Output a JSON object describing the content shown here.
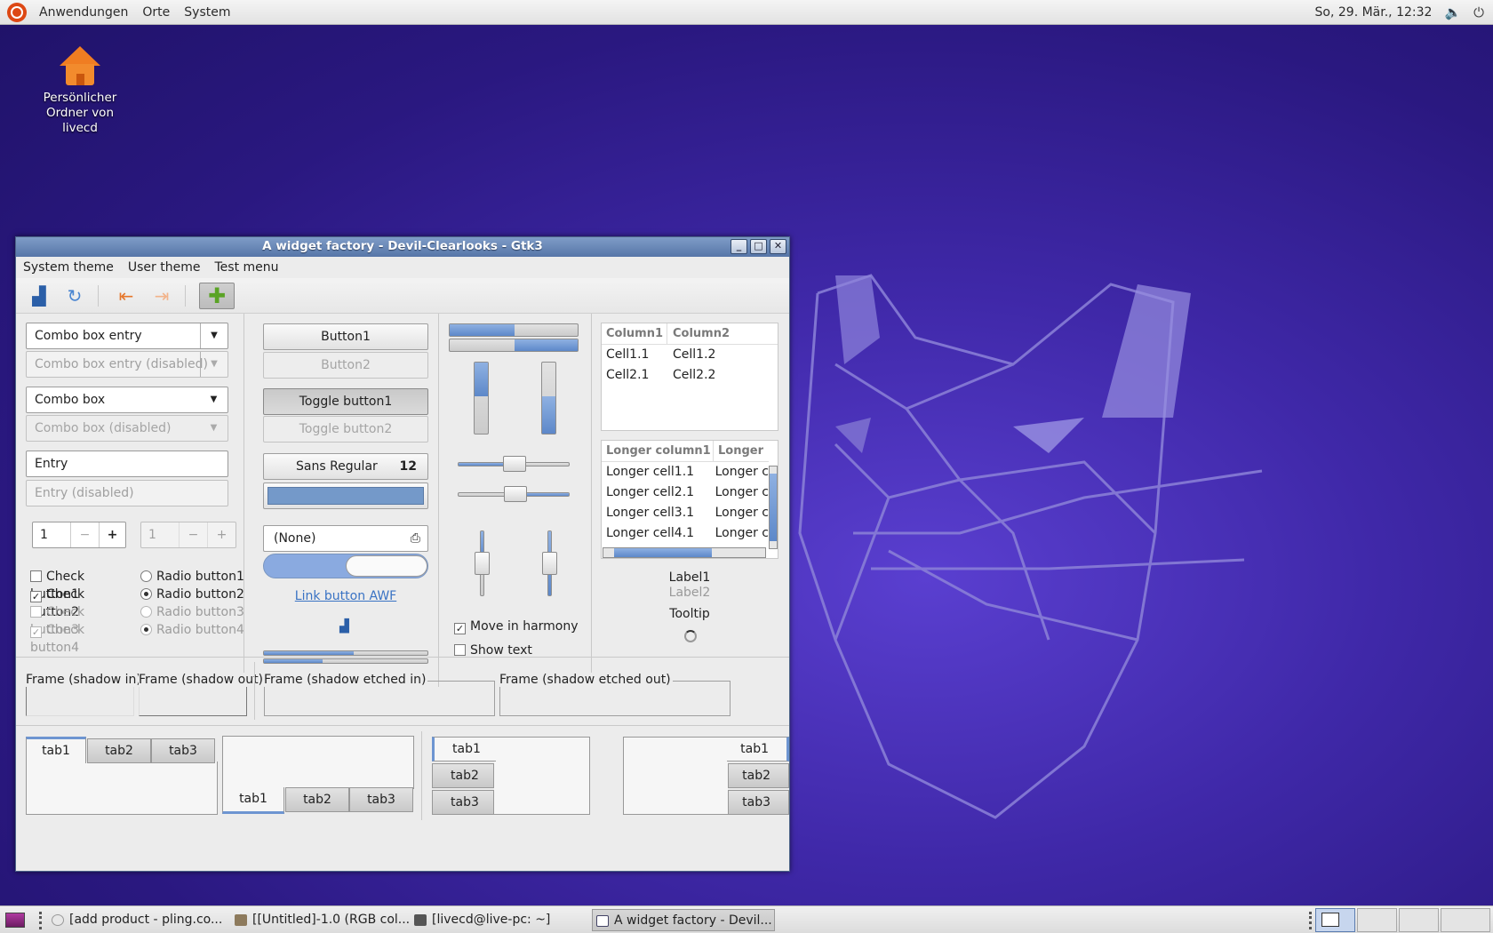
{
  "top_panel": {
    "menus": [
      "Anwendungen",
      "Orte",
      "System"
    ],
    "clock": "So, 29. Mär., 12:32"
  },
  "desktop": {
    "home_icon_label_line1": "Persönlicher",
    "home_icon_label_line2": "Ordner von livecd"
  },
  "window": {
    "title": "A widget factory - Devil-Clearlooks - Gtk3",
    "menubar": [
      "System theme",
      "User theme",
      "Test menu"
    ],
    "col1": {
      "combo_entry": "Combo box entry",
      "combo_entry_disabled": "Combo box entry (disabled)",
      "combo": "Combo box",
      "combo_disabled": "Combo box (disabled)",
      "entry": "Entry",
      "entry_disabled": "Entry (disabled)",
      "spin1": "1",
      "spin2": "1",
      "checks": [
        {
          "label": "Check button1",
          "checked": false,
          "disabled": false
        },
        {
          "label": "Check button2",
          "checked": true,
          "disabled": false
        },
        {
          "label": "Check button3",
          "checked": false,
          "disabled": true
        },
        {
          "label": "Check button4",
          "checked": true,
          "disabled": true
        }
      ],
      "radios": [
        {
          "label": "Radio button1",
          "checked": false,
          "disabled": false
        },
        {
          "label": "Radio button2",
          "checked": true,
          "disabled": false
        },
        {
          "label": "Radio button3",
          "checked": false,
          "disabled": true
        },
        {
          "label": "Radio button4",
          "checked": true,
          "disabled": true
        }
      ]
    },
    "col2": {
      "button1": "Button1",
      "button2": "Button2",
      "toggle1": "Toggle button1",
      "toggle2": "Toggle button2",
      "font_name": "Sans Regular",
      "font_size": "12",
      "file_chooser": "(None)",
      "link": "Link button AWF"
    },
    "col3": {
      "move_in_harmony": "Move in harmony",
      "show_text": "Show text"
    },
    "col4": {
      "tv1_headers": [
        "Column1",
        "Column2"
      ],
      "tv1_rows": [
        [
          "Cell1.1",
          "Cell1.2"
        ],
        [
          "Cell2.1",
          "Cell2.2"
        ]
      ],
      "tv2_headers": [
        "Longer column1",
        "Longer"
      ],
      "tv2_rows": [
        [
          "Longer cell1.1",
          "Longer c"
        ],
        [
          "Longer cell2.1",
          "Longer c"
        ],
        [
          "Longer cell3.1",
          "Longer c"
        ],
        [
          "Longer cell4.1",
          "Longer c"
        ]
      ],
      "label1": "Label1",
      "label2": "Label2",
      "tooltip": "Tooltip"
    },
    "frames": [
      "Frame (shadow in)",
      "Frame (shadow out)",
      "Frame (shadow etched in)",
      "Frame (shadow etched out)"
    ],
    "tabs": [
      "tab1",
      "tab2",
      "tab3"
    ]
  },
  "taskbar": {
    "tasks": [
      "[add product - pling.co...",
      "[[Untitled]-1.0 (RGB col...",
      "[livecd@live-pc: ~]",
      "A widget factory - Devil..."
    ]
  }
}
